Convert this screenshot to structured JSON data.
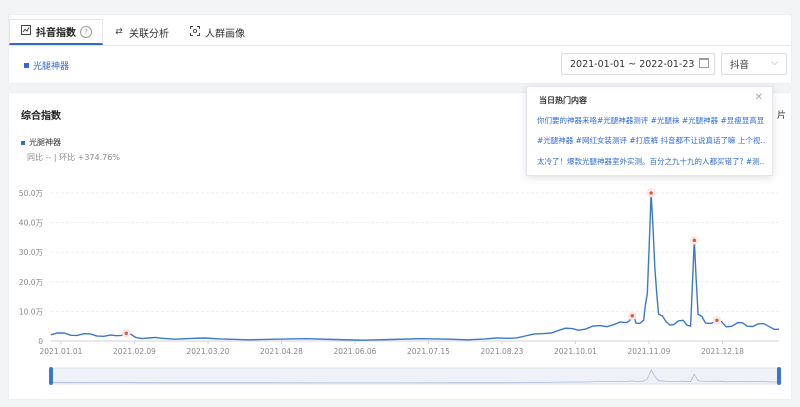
{
  "tabs": [
    {
      "label": "抖音指数",
      "icon": "trend-box-icon"
    },
    {
      "label": "关联分析",
      "icon": "swap-arrows-icon"
    },
    {
      "label": "人群画像",
      "icon": "face-scan-icon"
    }
  ],
  "keyword": "光腿神器",
  "filters": {
    "date_range": "2021-01-01 ~ 2022-01-23",
    "platform": "抖音"
  },
  "chart_panel": {
    "title": "综合指数",
    "legend": "光腿神器",
    "stats": "同比 -- | 环比 +374.76%",
    "corner_text": "片"
  },
  "popup": {
    "title": "当日热门内容",
    "items": [
      "你们要的神器来咯#光腿神器测评 #光腿袜 #光腿神器 #显瘦显高显...",
      "#光腿神器 #网红女装测评 #打底裤 抖音都不让说真话了嘛 上个视...",
      "太冷了！爆款光腿神器室外实测。百分之九十九的人都买错了? #测..."
    ]
  },
  "colors": {
    "accent": "#2f6bd8",
    "line": "#3b78cc",
    "marker": "#e8583a"
  },
  "chart_data": {
    "type": "line",
    "title": "",
    "xlabel": "",
    "ylabel": "",
    "y_ticks": [
      "0",
      "10.0万",
      "20.0万",
      "30.0万",
      "40.0万",
      "50.0万"
    ],
    "x_ticks": [
      "2021.01.01",
      "2021.02.09",
      "2021.03.20",
      "2021.04.28",
      "2021.06.06",
      "2021.07.15",
      "2021.08.23",
      "2021.10.01",
      "2021.11.09",
      "2021.12.18"
    ],
    "ylim": [
      0,
      500000
    ],
    "x_start": "2021-01-01",
    "x_end": "2022-01-23",
    "series": [
      {
        "name": "光腿神器",
        "points": [
          [
            "2021-01-01",
            21000
          ],
          [
            "2021-01-08",
            27000
          ],
          [
            "2021-01-15",
            19000
          ],
          [
            "2021-01-22",
            24000
          ],
          [
            "2021-01-29",
            16000
          ],
          [
            "2021-02-05",
            18000
          ],
          [
            "2021-02-10",
            26000
          ],
          [
            "2021-02-15",
            12000
          ],
          [
            "2021-02-22",
            10000
          ],
          [
            "2021-03-01",
            9000
          ],
          [
            "2021-03-15",
            8000
          ],
          [
            "2021-04-01",
            7000
          ],
          [
            "2021-05-01",
            6000
          ],
          [
            "2021-06-01",
            5000
          ],
          [
            "2021-07-01",
            5000
          ],
          [
            "2021-08-01",
            6000
          ],
          [
            "2021-08-20",
            7000
          ],
          [
            "2021-09-01",
            9000
          ],
          [
            "2021-09-10",
            17000
          ],
          [
            "2021-09-20",
            25000
          ],
          [
            "2021-09-28",
            36000
          ],
          [
            "2021-10-05",
            42000
          ],
          [
            "2021-10-12",
            40000
          ],
          [
            "2021-10-20",
            52000
          ],
          [
            "2021-10-27",
            55000
          ],
          [
            "2021-11-03",
            62000
          ],
          [
            "2021-11-06",
            85000
          ],
          [
            "2021-11-08",
            60000
          ],
          [
            "2021-11-12",
            70000
          ],
          [
            "2021-11-14",
            160000
          ],
          [
            "2021-11-16",
            500000
          ],
          [
            "2021-11-18",
            250000
          ],
          [
            "2021-11-20",
            90000
          ],
          [
            "2021-11-24",
            65000
          ],
          [
            "2021-11-28",
            55000
          ],
          [
            "2021-12-03",
            70000
          ],
          [
            "2021-12-07",
            50000
          ],
          [
            "2021-12-09",
            340000
          ],
          [
            "2021-12-11",
            90000
          ],
          [
            "2021-12-15",
            60000
          ],
          [
            "2021-12-21",
            70000
          ],
          [
            "2021-12-26",
            48000
          ],
          [
            "2022-01-01",
            62000
          ],
          [
            "2022-01-06",
            50000
          ],
          [
            "2022-01-12",
            58000
          ],
          [
            "2022-01-18",
            48000
          ],
          [
            "2022-01-23",
            40000
          ]
        ]
      }
    ],
    "highlight_points": [
      [
        "2021-02-10",
        26000
      ],
      [
        "2021-11-06",
        85000
      ],
      [
        "2021-11-16",
        500000
      ],
      [
        "2021-12-09",
        340000
      ],
      [
        "2021-12-21",
        70000
      ]
    ]
  }
}
